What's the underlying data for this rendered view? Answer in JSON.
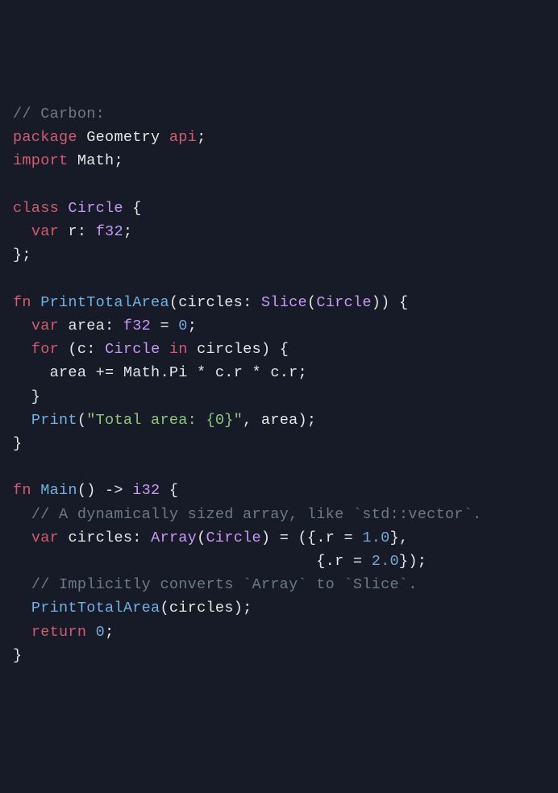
{
  "language": "Carbon",
  "tokens": [
    [
      [
        "c-comment",
        "// Carbon:"
      ]
    ],
    [
      [
        "c-keyword",
        "package"
      ],
      [
        "c-punct",
        " "
      ],
      [
        "c-ident",
        "Geometry"
      ],
      [
        "c-punct",
        " "
      ],
      [
        "c-keyword",
        "api"
      ],
      [
        "c-punct",
        ";"
      ]
    ],
    [
      [
        "c-keyword",
        "import"
      ],
      [
        "c-punct",
        " "
      ],
      [
        "c-ident",
        "Math"
      ],
      [
        "c-punct",
        ";"
      ]
    ],
    [],
    [
      [
        "c-keyword",
        "class"
      ],
      [
        "c-punct",
        " "
      ],
      [
        "c-type",
        "Circle"
      ],
      [
        "c-punct",
        " {"
      ]
    ],
    [
      [
        "c-punct",
        "  "
      ],
      [
        "c-keyword",
        "var"
      ],
      [
        "c-punct",
        " "
      ],
      [
        "c-ident",
        "r"
      ],
      [
        "c-punct",
        ": "
      ],
      [
        "c-type",
        "f32"
      ],
      [
        "c-punct",
        ";"
      ]
    ],
    [
      [
        "c-punct",
        "};"
      ]
    ],
    [],
    [
      [
        "c-keyword",
        "fn"
      ],
      [
        "c-punct",
        " "
      ],
      [
        "c-func",
        "PrintTotalArea"
      ],
      [
        "c-punct",
        "("
      ],
      [
        "c-ident",
        "circles"
      ],
      [
        "c-punct",
        ": "
      ],
      [
        "c-type",
        "Slice"
      ],
      [
        "c-punct",
        "("
      ],
      [
        "c-type",
        "Circle"
      ],
      [
        "c-punct",
        ")) {"
      ]
    ],
    [
      [
        "c-punct",
        "  "
      ],
      [
        "c-keyword",
        "var"
      ],
      [
        "c-punct",
        " "
      ],
      [
        "c-ident",
        "area"
      ],
      [
        "c-punct",
        ": "
      ],
      [
        "c-type",
        "f32"
      ],
      [
        "c-punct",
        " = "
      ],
      [
        "c-number",
        "0"
      ],
      [
        "c-punct",
        ";"
      ]
    ],
    [
      [
        "c-punct",
        "  "
      ],
      [
        "c-keyword",
        "for"
      ],
      [
        "c-punct",
        " ("
      ],
      [
        "c-ident",
        "c"
      ],
      [
        "c-punct",
        ": "
      ],
      [
        "c-type",
        "Circle"
      ],
      [
        "c-punct",
        " "
      ],
      [
        "c-keyword",
        "in"
      ],
      [
        "c-punct",
        " "
      ],
      [
        "c-ident",
        "circles"
      ],
      [
        "c-punct",
        ") {"
      ]
    ],
    [
      [
        "c-punct",
        "    "
      ],
      [
        "c-ident",
        "area"
      ],
      [
        "c-punct",
        " += "
      ],
      [
        "c-ident",
        "Math"
      ],
      [
        "c-punct",
        "."
      ],
      [
        "c-ident",
        "Pi"
      ],
      [
        "c-punct",
        " * "
      ],
      [
        "c-ident",
        "c"
      ],
      [
        "c-punct",
        "."
      ],
      [
        "c-ident",
        "r"
      ],
      [
        "c-punct",
        " * "
      ],
      [
        "c-ident",
        "c"
      ],
      [
        "c-punct",
        "."
      ],
      [
        "c-ident",
        "r"
      ],
      [
        "c-punct",
        ";"
      ]
    ],
    [
      [
        "c-punct",
        "  }"
      ]
    ],
    [
      [
        "c-punct",
        "  "
      ],
      [
        "c-func",
        "Print"
      ],
      [
        "c-punct",
        "("
      ],
      [
        "c-string",
        "\"Total area: {0}\""
      ],
      [
        "c-punct",
        ", "
      ],
      [
        "c-ident",
        "area"
      ],
      [
        "c-punct",
        ");"
      ]
    ],
    [
      [
        "c-punct",
        "}"
      ]
    ],
    [],
    [
      [
        "c-keyword",
        "fn"
      ],
      [
        "c-punct",
        " "
      ],
      [
        "c-func",
        "Main"
      ],
      [
        "c-punct",
        "() -> "
      ],
      [
        "c-type",
        "i32"
      ],
      [
        "c-punct",
        " {"
      ]
    ],
    [
      [
        "c-punct",
        "  "
      ],
      [
        "c-comment",
        "// A dynamically sized array, like `std::vector`."
      ]
    ],
    [
      [
        "c-punct",
        "  "
      ],
      [
        "c-keyword",
        "var"
      ],
      [
        "c-punct",
        " "
      ],
      [
        "c-ident",
        "circles"
      ],
      [
        "c-punct",
        ": "
      ],
      [
        "c-type",
        "Array"
      ],
      [
        "c-punct",
        "("
      ],
      [
        "c-type",
        "Circle"
      ],
      [
        "c-punct",
        ") = ({."
      ],
      [
        "c-ident",
        "r"
      ],
      [
        "c-punct",
        " = "
      ],
      [
        "c-number",
        "1.0"
      ],
      [
        "c-punct",
        "},"
      ]
    ],
    [
      [
        "c-punct",
        "                                 {."
      ],
      [
        "c-ident",
        "r"
      ],
      [
        "c-punct",
        " = "
      ],
      [
        "c-number",
        "2.0"
      ],
      [
        "c-punct",
        "});"
      ]
    ],
    [
      [
        "c-punct",
        "  "
      ],
      [
        "c-comment",
        "// Implicitly converts `Array` to `Slice`."
      ]
    ],
    [
      [
        "c-punct",
        "  "
      ],
      [
        "c-func",
        "PrintTotalArea"
      ],
      [
        "c-punct",
        "("
      ],
      [
        "c-ident",
        "circles"
      ],
      [
        "c-punct",
        ");"
      ]
    ],
    [
      [
        "c-punct",
        "  "
      ],
      [
        "c-keyword",
        "return"
      ],
      [
        "c-punct",
        " "
      ],
      [
        "c-number",
        "0"
      ],
      [
        "c-punct",
        ";"
      ]
    ],
    [
      [
        "c-punct",
        "}"
      ]
    ]
  ]
}
